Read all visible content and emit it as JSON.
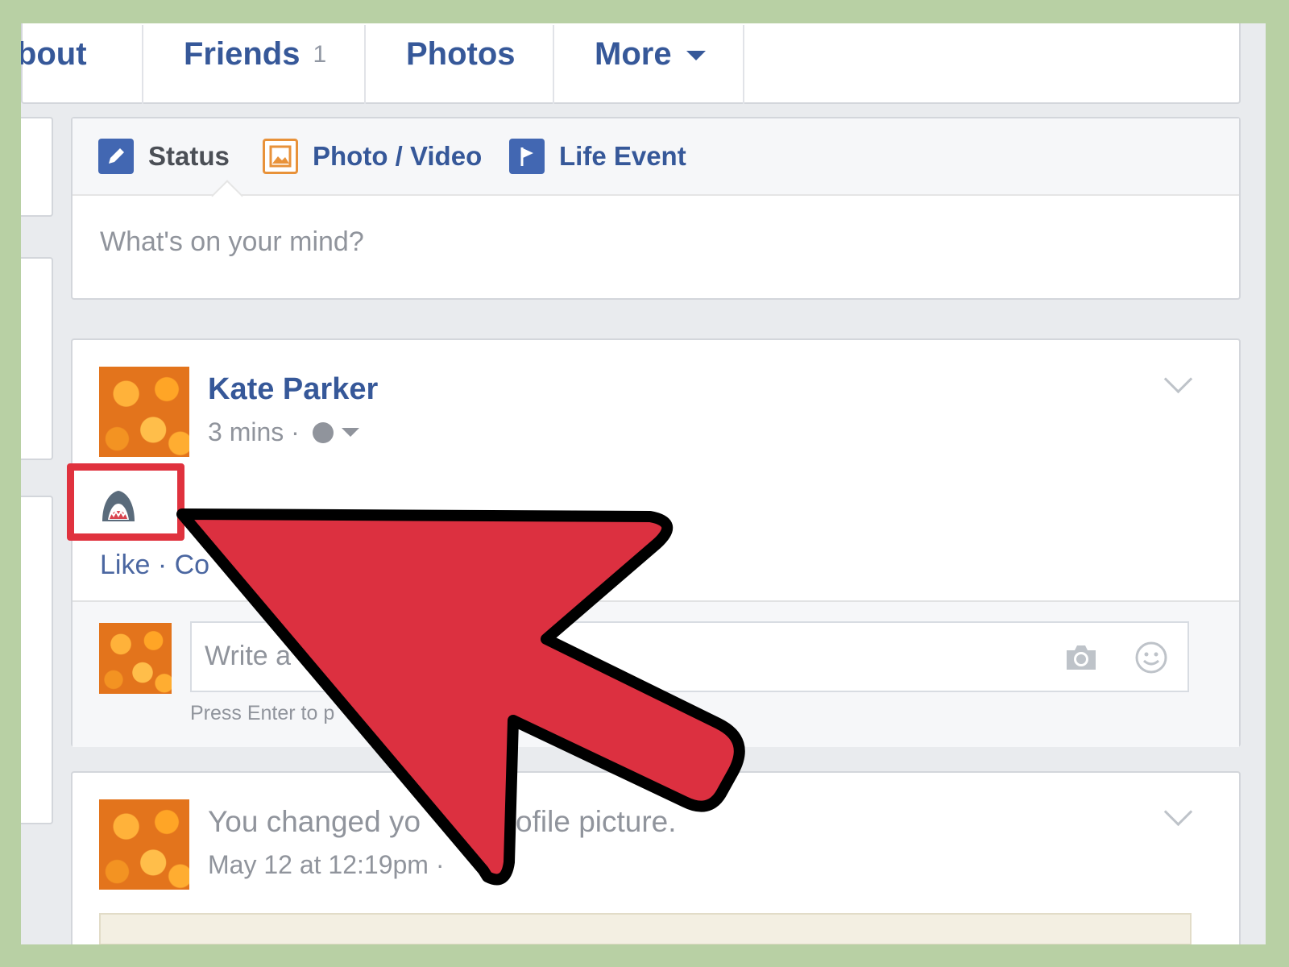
{
  "nav": {
    "tabs": [
      {
        "label": "About"
      },
      {
        "label": "Friends",
        "count": "1"
      },
      {
        "label": "Photos"
      },
      {
        "label": "More"
      }
    ]
  },
  "composer": {
    "tabs": [
      {
        "label": "Status",
        "icon": "pencil-icon",
        "color": "#4267b2"
      },
      {
        "label": "Photo / Video",
        "icon": "photo-icon",
        "color": "#e8923a"
      },
      {
        "label": "Life Event",
        "icon": "flag-icon",
        "color": "#4267b2"
      }
    ],
    "placeholder": "What's on your mind?"
  },
  "post1": {
    "author": "Kate Parker",
    "time": "3 mins ·",
    "content_icon": "shark-emoticon",
    "actions": "Like · Co",
    "comment_placeholder": "Write a c",
    "press_enter": "Press Enter to p"
  },
  "post2": {
    "text": "You changed yo",
    "text_tail": "ofile picture.",
    "time": "May 12 at 12:19pm ·"
  },
  "colors": {
    "frame": "#b8d0a4",
    "link_blue": "#365899",
    "arrow_red": "#dc3040",
    "highlight_red": "#e0323e"
  }
}
